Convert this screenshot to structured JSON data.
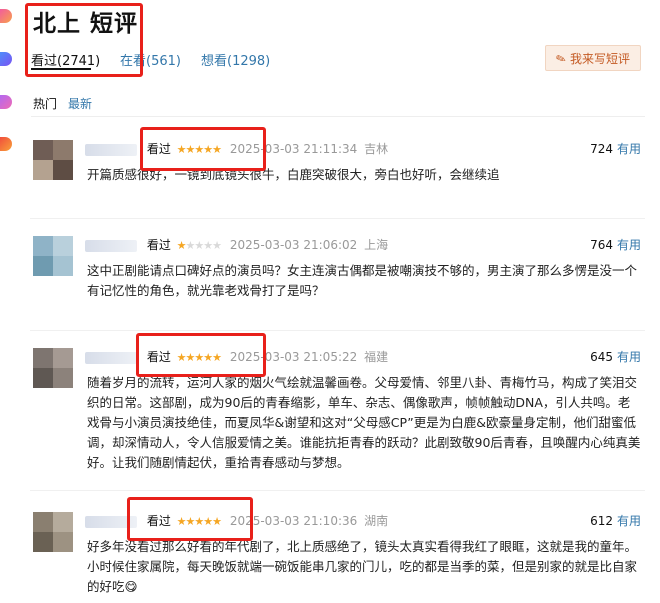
{
  "page": {
    "title": "北上 短评"
  },
  "tabs": [
    {
      "label": "看过(2741)",
      "active": true
    },
    {
      "label": "在看(561)",
      "active": false
    },
    {
      "label": "想看(1298)",
      "active": false
    }
  ],
  "write_button": {
    "label": "我来写短评",
    "icon": "pencil-icon"
  },
  "sort": {
    "hot": "热门",
    "new": "最新"
  },
  "comments": [
    {
      "status": "看过",
      "stars": 5,
      "time": "2025-03-03 21:11:34",
      "location": "吉林",
      "votes": "724",
      "useful": "有用",
      "text": "开篇质感很好，一镜到底镜头很牛，白鹿突破很大，旁白也好听，会继续追"
    },
    {
      "status": "看过",
      "stars": 1,
      "time": "2025-03-03 21:06:02",
      "location": "上海",
      "votes": "764",
      "useful": "有用",
      "text": "这中正剧能请点口碑好点的演员吗？女主连演古偶都是被嘲演技不够的，男主演了那么多愣是没一个有记忆性的角色，就光靠老戏骨打了是吗？"
    },
    {
      "status": "看过",
      "stars": 5,
      "time": "2025-03-03 21:05:22",
      "location": "福建",
      "votes": "645",
      "useful": "有用",
      "text": "随着岁月的流转，运河人家的烟火气绘就温馨画卷。父母爱情、邻里八卦、青梅竹马，构成了笑泪交织的日常。这部剧，成为90后的青春缩影，单车、杂志、偶像歌声，帧帧触动DNA，引人共鸣。老戏骨与小演员演技绝佳，而夏凤华&谢望和这对“父母感CP”更是为白鹿&欧豪量身定制，他们甜蜜低调，却深情动人，令人信服爱情之美。谁能抗拒青春的跃动？此剧致敬90后青春，且唤醒内心纯真美好。让我们随剧情起伏，重拾青春感动与梦想。"
    },
    {
      "status": "看过",
      "stars": 5,
      "time": "2025-03-03 21:10:36",
      "location": "湖南",
      "votes": "612",
      "useful": "有用",
      "text": "好多年没看过那么好看的年代剧了，北上质感绝了，镜头太真实看得我红了眼眶，这就是我的童年。小时候住家属院，每天晚饭就端一碗饭能串几家的门儿，吃的都是当季的菜，但是别家的就是比自家的好吃😋"
    }
  ],
  "colors": {
    "link": "#3377aa",
    "star": "#f5a623",
    "highlight_box": "#e8201a",
    "write_bg": "#fbeee4"
  }
}
